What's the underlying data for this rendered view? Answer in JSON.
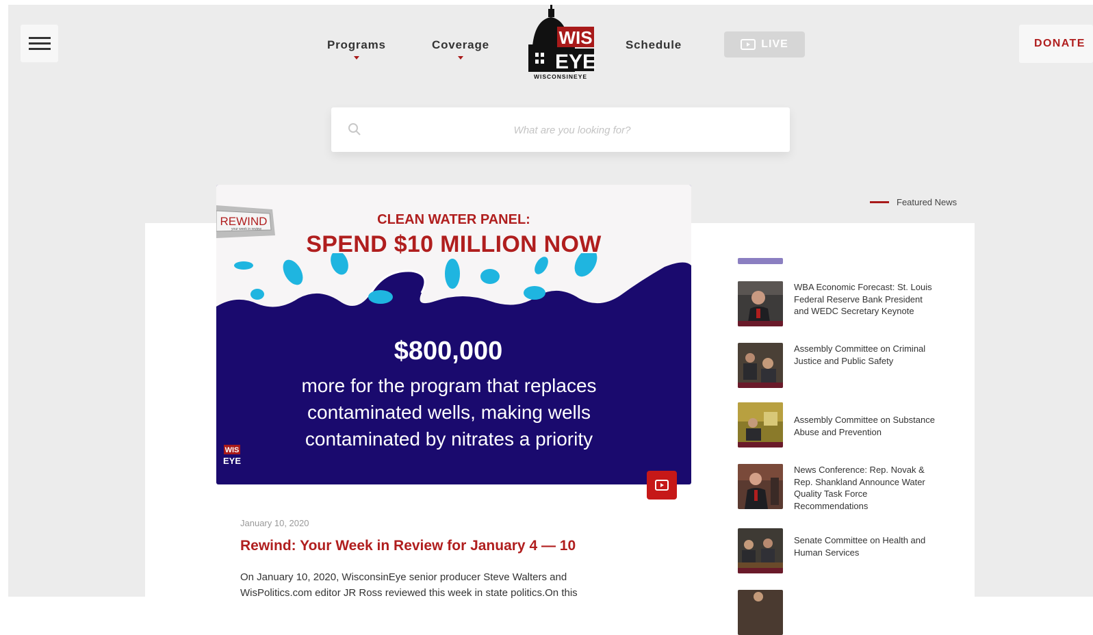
{
  "header": {
    "menu_icon": "hamburger-icon",
    "nav": [
      {
        "label": "Programs"
      },
      {
        "label": "Coverage"
      },
      {
        "label": "Schedule"
      }
    ],
    "logo": {
      "top": "WIS",
      "bottom": "EYE",
      "caption": "WISCONSINEYE"
    },
    "live_label": "LIVE",
    "donate_label": "DONATE"
  },
  "search": {
    "placeholder": "What are you looking for?",
    "value": ""
  },
  "featured_label": "Featured News",
  "hero": {
    "badge": "REWIND",
    "badge_sub": "your week in review",
    "subtitle": "CLEAN WATER PANEL:",
    "title": "SPEND $10 MILLION NOW",
    "amount": "$800,000",
    "description": "more for the program that replaces contaminated wells, making wells contaminated by nitrates a priority",
    "watermark_top": "WIS",
    "watermark_bottom": "EYE"
  },
  "post": {
    "date": "January 10, 2020",
    "title": "Rewind: Your Week in Review for January 4 — 10",
    "excerpt": "On January 10, 2020, WisconsinEye senior producer Steve Walters and WisPolitics.com editor JR Ross reviewed this week in state politics.On this"
  },
  "news": [
    {
      "title": "WBA Economic Forecast: St. Louis Federal Reserve Bank President and WEDC Secretary Keynote"
    },
    {
      "title": "Assembly Committee on Criminal Justice and Public Safety"
    },
    {
      "title": "Assembly Committee on Substance Abuse and Prevention"
    },
    {
      "title": "News Conference: Rep. Novak & Rep. Shankland Announce Water Quality Task Force Recommendations"
    },
    {
      "title": "Senate Committee on Health and Human Services"
    }
  ],
  "colors": {
    "brand_red": "#b01e1e",
    "hero_navy": "#1a0a6e",
    "water_cyan": "#1fb5e0",
    "background": "#ececec"
  }
}
